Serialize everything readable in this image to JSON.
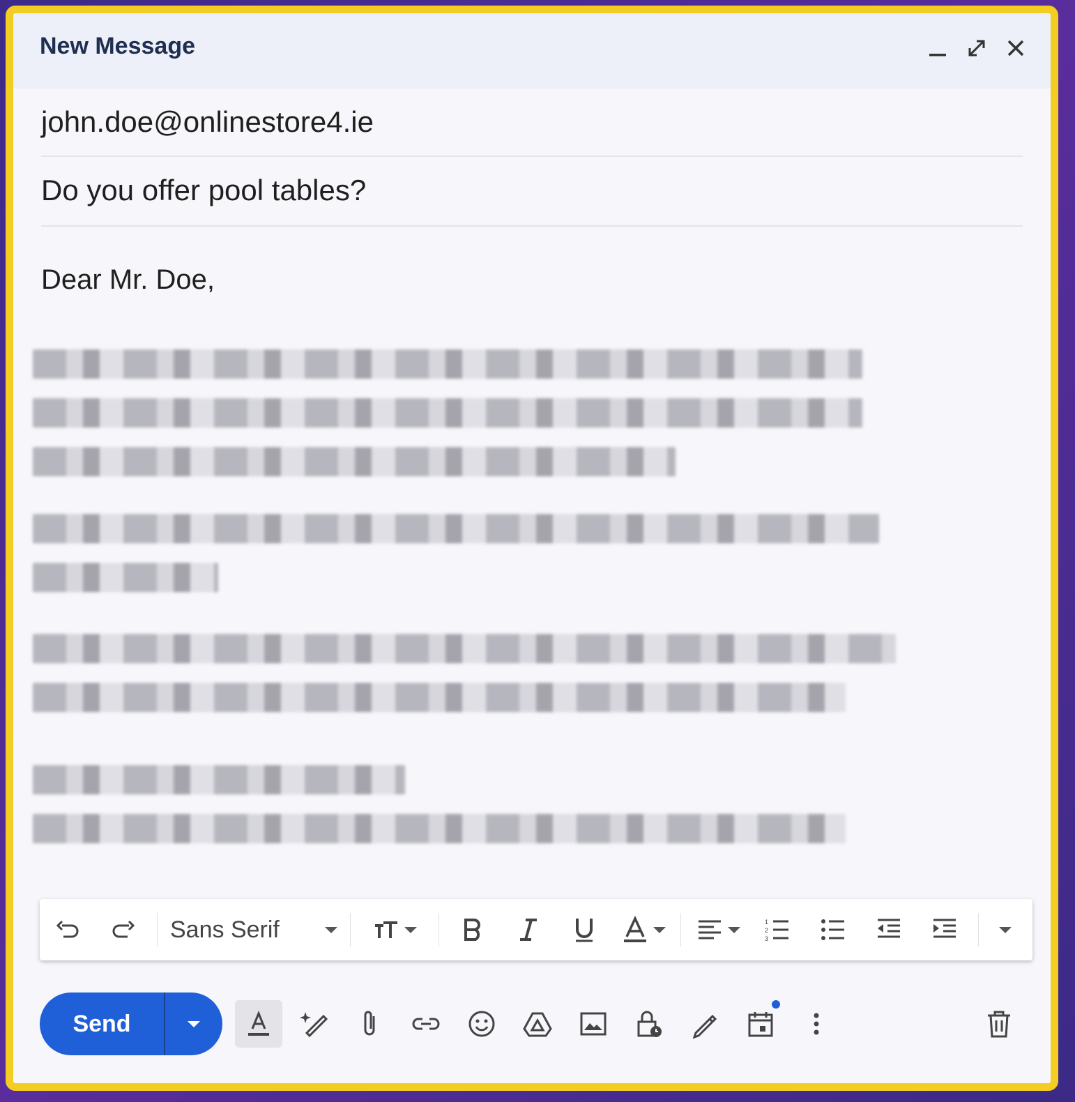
{
  "window": {
    "title": "New Message"
  },
  "compose": {
    "to": "john.doe@onlinestore4.ie",
    "subject": "Do you offer pool tables?",
    "greeting": "Dear Mr. Doe,"
  },
  "toolbar": {
    "font": "Sans Serif"
  },
  "send": {
    "label": "Send"
  },
  "colors": {
    "accent": "#1f60d8",
    "frame": "#f3cd22"
  }
}
